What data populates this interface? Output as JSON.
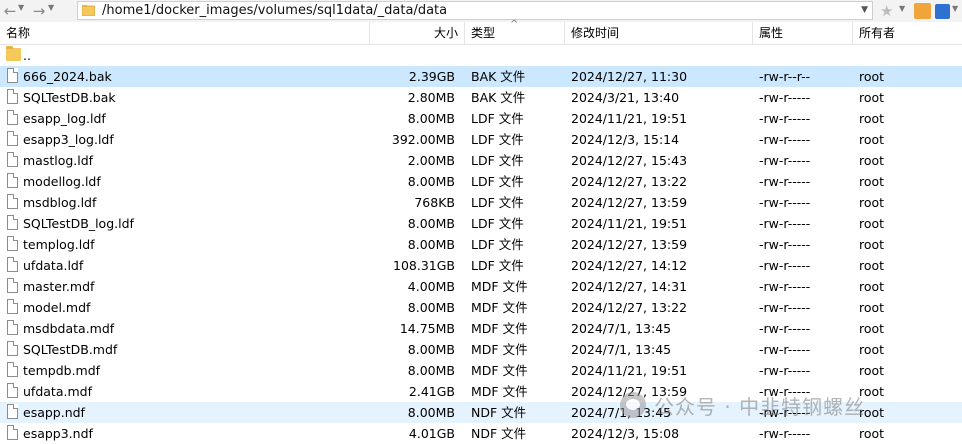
{
  "toolbar": {
    "path": "/home1/docker_images/volumes/sql1data/_data/data"
  },
  "columns": {
    "name": "名称",
    "size": "大小",
    "type": "类型",
    "date": "修改时间",
    "perm": "属性",
    "owner": "所有者"
  },
  "parent": {
    "name": ".."
  },
  "files": [
    {
      "name": "666_2024.bak",
      "size": "2.39GB",
      "type": "BAK 文件",
      "date": "2024/12/27, 11:30",
      "perm": "-rw-r--r--",
      "owner": "root"
    },
    {
      "name": "SQLTestDB.bak",
      "size": "2.80MB",
      "type": "BAK 文件",
      "date": "2024/3/21, 13:40",
      "perm": "-rw-r-----",
      "owner": "root"
    },
    {
      "name": "esapp_log.ldf",
      "size": "8.00MB",
      "type": "LDF 文件",
      "date": "2024/11/21, 19:51",
      "perm": "-rw-r-----",
      "owner": "root"
    },
    {
      "name": "esapp3_log.ldf",
      "size": "392.00MB",
      "type": "LDF 文件",
      "date": "2024/12/3, 15:14",
      "perm": "-rw-r-----",
      "owner": "root"
    },
    {
      "name": "mastlog.ldf",
      "size": "2.00MB",
      "type": "LDF 文件",
      "date": "2024/12/27, 15:43",
      "perm": "-rw-r-----",
      "owner": "root"
    },
    {
      "name": "modellog.ldf",
      "size": "8.00MB",
      "type": "LDF 文件",
      "date": "2024/12/27, 13:22",
      "perm": "-rw-r-----",
      "owner": "root"
    },
    {
      "name": "msdblog.ldf",
      "size": "768KB",
      "type": "LDF 文件",
      "date": "2024/12/27, 13:59",
      "perm": "-rw-r-----",
      "owner": "root"
    },
    {
      "name": "SQLTestDB_log.ldf",
      "size": "8.00MB",
      "type": "LDF 文件",
      "date": "2024/11/21, 19:51",
      "perm": "-rw-r-----",
      "owner": "root"
    },
    {
      "name": "templog.ldf",
      "size": "8.00MB",
      "type": "LDF 文件",
      "date": "2024/12/27, 13:59",
      "perm": "-rw-r-----",
      "owner": "root"
    },
    {
      "name": "ufdata.ldf",
      "size": "108.31GB",
      "type": "LDF 文件",
      "date": "2024/12/27, 14:12",
      "perm": "-rw-r-----",
      "owner": "root"
    },
    {
      "name": "master.mdf",
      "size": "4.00MB",
      "type": "MDF 文件",
      "date": "2024/12/27, 14:31",
      "perm": "-rw-r-----",
      "owner": "root"
    },
    {
      "name": "model.mdf",
      "size": "8.00MB",
      "type": "MDF 文件",
      "date": "2024/12/27, 13:22",
      "perm": "-rw-r-----",
      "owner": "root"
    },
    {
      "name": "msdbdata.mdf",
      "size": "14.75MB",
      "type": "MDF 文件",
      "date": "2024/7/1, 13:45",
      "perm": "-rw-r-----",
      "owner": "root"
    },
    {
      "name": "SQLTestDB.mdf",
      "size": "8.00MB",
      "type": "MDF 文件",
      "date": "2024/7/1, 13:45",
      "perm": "-rw-r-----",
      "owner": "root"
    },
    {
      "name": "tempdb.mdf",
      "size": "8.00MB",
      "type": "MDF 文件",
      "date": "2024/11/21, 19:51",
      "perm": "-rw-r-----",
      "owner": "root"
    },
    {
      "name": "ufdata.mdf",
      "size": "2.41GB",
      "type": "MDF 文件",
      "date": "2024/12/27, 13:59",
      "perm": "-rw-r-----",
      "owner": "root"
    },
    {
      "name": "esapp.ndf",
      "size": "8.00MB",
      "type": "NDF 文件",
      "date": "2024/7/1, 13:45",
      "perm": "-rw-r-----",
      "owner": "root"
    },
    {
      "name": "esapp3.ndf",
      "size": "4.01GB",
      "type": "NDF 文件",
      "date": "2024/12/3, 15:08",
      "perm": "-rw-r-----",
      "owner": "root"
    }
  ],
  "selected_index": 0,
  "hover_index": 16,
  "watermark": "公众号 · 中韭特钢螺丝",
  "colors": {
    "selected_row": "#cce8ff",
    "hover_row": "#e5f3ff",
    "folder": "#f5c85c"
  }
}
